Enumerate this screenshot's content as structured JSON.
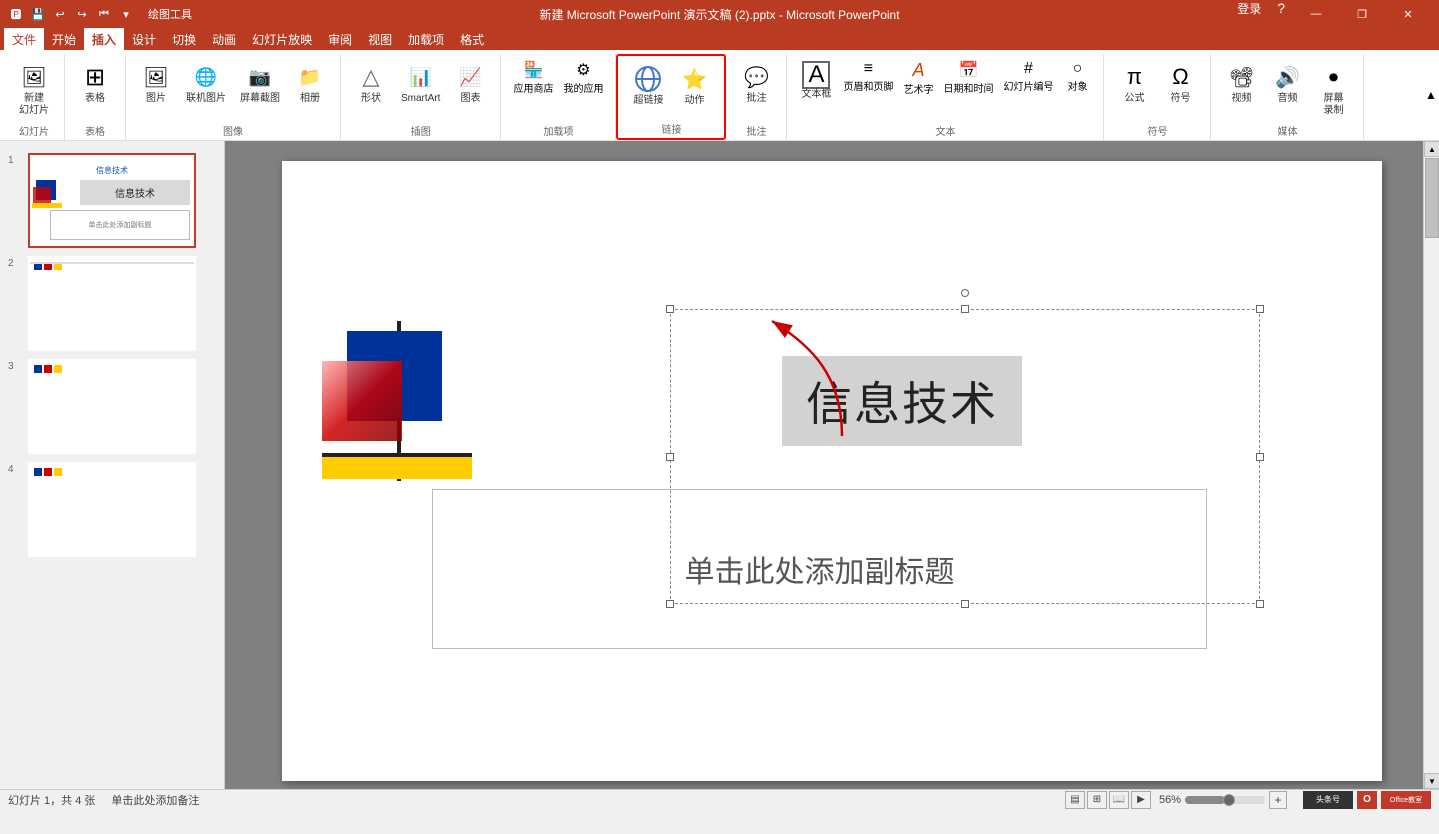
{
  "titlebar": {
    "title": "新建 Microsoft PowerPoint 演示文稿 (2).pptx - Microsoft PowerPoint",
    "left_icons": [
      "💾",
      "↩",
      "↪",
      "⏮",
      "📋"
    ],
    "drawing_tools": "绘图工具",
    "login": "登录"
  },
  "menubar": {
    "items": [
      "文件",
      "开始",
      "插入",
      "设计",
      "切换",
      "动画",
      "幻灯片放映",
      "审阅",
      "视图",
      "加载项",
      "格式"
    ]
  },
  "ribbon": {
    "active_tab": "插入",
    "groups": [
      {
        "name": "幻灯片",
        "items": [
          {
            "label": "新建\n幻灯片",
            "icon": "🖼"
          }
        ]
      },
      {
        "name": "表格",
        "items": [
          {
            "label": "表格",
            "icon": "⊞"
          }
        ]
      },
      {
        "name": "图像",
        "items": [
          {
            "label": "图片",
            "icon": "🖼"
          },
          {
            "label": "联机图片",
            "icon": "🌐"
          },
          {
            "label": "屏幕截图",
            "icon": "📷"
          },
          {
            "label": "相册",
            "icon": "📁"
          }
        ]
      },
      {
        "name": "插图",
        "items": [
          {
            "label": "形状",
            "icon": "△"
          },
          {
            "label": "SmartArt",
            "icon": "📊"
          },
          {
            "label": "图表",
            "icon": "📈"
          }
        ]
      },
      {
        "name": "加载项",
        "items": [
          {
            "label": "应用商店",
            "icon": "🏪"
          },
          {
            "label": "我的应用",
            "icon": "⚙"
          }
        ]
      },
      {
        "name": "链接",
        "highlighted": true,
        "items": [
          {
            "label": "超链接",
            "icon": "🔗"
          },
          {
            "label": "动作",
            "icon": "⭐"
          }
        ]
      },
      {
        "name": "批注",
        "items": [
          {
            "label": "批注",
            "icon": "💬"
          }
        ]
      },
      {
        "name": "文本",
        "items": [
          {
            "label": "文本框",
            "icon": "A"
          },
          {
            "label": "页眉和页脚",
            "icon": "≡"
          },
          {
            "label": "艺术字",
            "icon": "A"
          },
          {
            "label": "日期和时间",
            "icon": "📅"
          },
          {
            "label": "幻灯片\n编号",
            "icon": "#"
          },
          {
            "label": "对象",
            "icon": "○"
          }
        ]
      },
      {
        "name": "符号",
        "items": [
          {
            "label": "公式",
            "icon": "π"
          },
          {
            "label": "符号",
            "icon": "Ω"
          }
        ]
      },
      {
        "name": "媒体",
        "items": [
          {
            "label": "视频",
            "icon": "▶"
          },
          {
            "label": "音频",
            "icon": "🔊"
          },
          {
            "label": "屏幕\n录制",
            "icon": "⏺"
          }
        ]
      }
    ]
  },
  "slides": [
    {
      "number": "1",
      "selected": true,
      "title": "信息技术",
      "has_content": true
    },
    {
      "number": "2",
      "selected": false,
      "has_content": false
    },
    {
      "number": "3",
      "selected": false,
      "has_content": false
    },
    {
      "number": "4",
      "selected": false,
      "has_content": false
    }
  ],
  "canvas": {
    "title": "信息技术",
    "subtitle_placeholder": "单击此处添加副标题",
    "notes_placeholder": "单击此处添加备注"
  },
  "statusbar": {
    "slide_info": "幻灯片 1，共 4 张",
    "notes": "单击此处添加备注",
    "theme": "",
    "view_btns": [
      "普通",
      "幻灯片浏览",
      "阅读视图",
      "幻灯片放映"
    ]
  }
}
